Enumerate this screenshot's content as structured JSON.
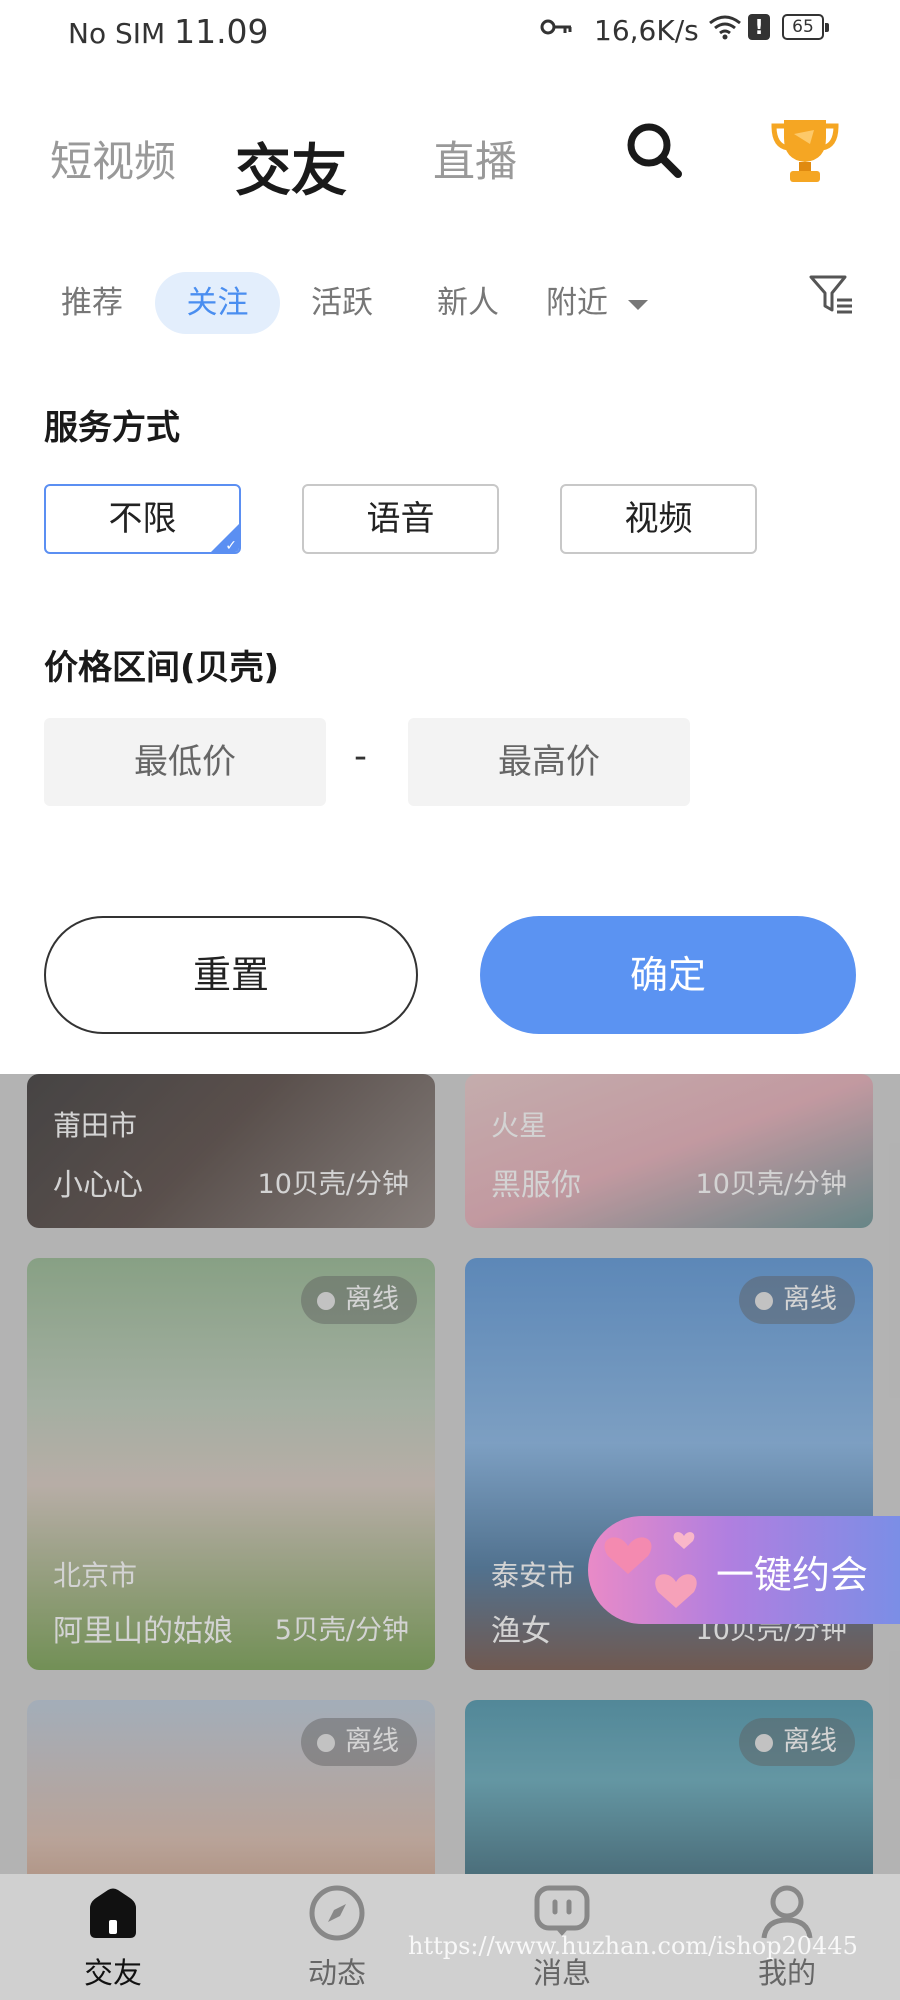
{
  "status_bar": {
    "carrier": "No SIM",
    "time": "11.09",
    "speed": "16,6K/s",
    "alert": "!",
    "battery": "65"
  },
  "top_tabs": [
    {
      "label": "短视频"
    },
    {
      "label": "交友"
    },
    {
      "label": "直播"
    }
  ],
  "sub_tabs": [
    {
      "label": "推荐"
    },
    {
      "label": "关注"
    },
    {
      "label": "活跃"
    },
    {
      "label": "新人"
    },
    {
      "label": "附近"
    }
  ],
  "filter": {
    "service_title": "服务方式",
    "service_options": [
      "不限",
      "语音",
      "视频"
    ],
    "selected_service": "不限",
    "price_title": "价格区间(贝壳)",
    "min_placeholder": "最低价",
    "dash": "-",
    "max_placeholder": "最高价",
    "reset_label": "重置",
    "confirm_label": "确定"
  },
  "cards": [
    {
      "city": "莆田市",
      "nick": "小心心",
      "price": "10贝壳/分钟"
    },
    {
      "city": "火星",
      "nick": "黑服你",
      "price": "10贝壳/分钟"
    },
    {
      "status": "离线",
      "city": "北京市",
      "nick": "阿里山的姑娘",
      "price": "5贝壳/分钟"
    },
    {
      "status": "离线",
      "city": "泰安市",
      "nick": "渔女",
      "price": "10贝壳/分钟"
    },
    {
      "status": "离线"
    },
    {
      "status": "离线"
    }
  ],
  "float_button": {
    "label": "一键约会"
  },
  "bottom_nav": [
    {
      "label": "交友",
      "icon": "home-icon"
    },
    {
      "label": "动态",
      "icon": "compass-icon"
    },
    {
      "label": "消息",
      "icon": "message-icon"
    },
    {
      "label": "我的",
      "icon": "user-icon"
    }
  ],
  "watermark": "https://www.huzhan.com/ishop20445",
  "colors": {
    "accent": "#5b93f2",
    "selected_tab_bg": "#e3eefc",
    "trophy": "#f5a623"
  }
}
